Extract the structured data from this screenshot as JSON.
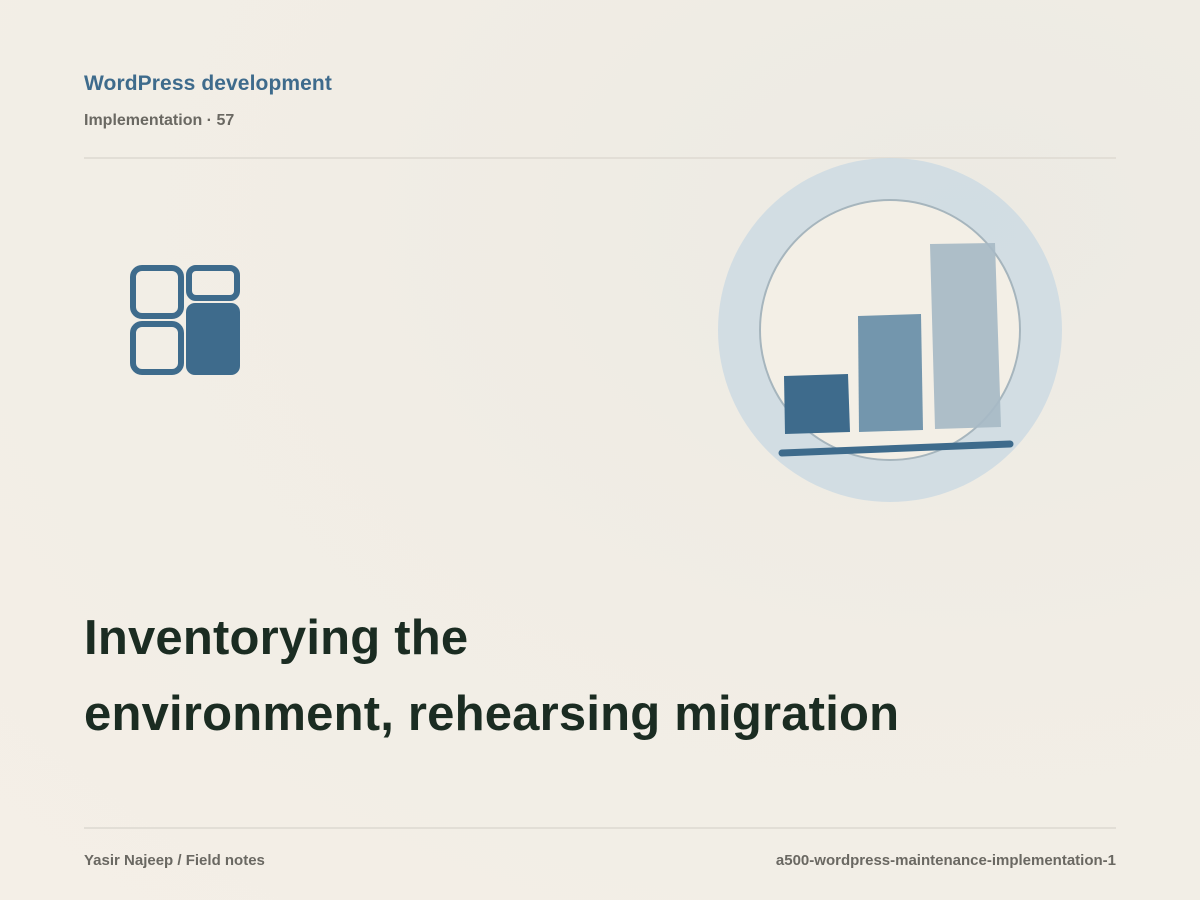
{
  "header": {
    "brand": "WordPress development",
    "meta": "Implementation · 57"
  },
  "headline": {
    "line1": "Inventorying the",
    "line2": "environment, rehearsing migration"
  },
  "footer": {
    "author": "Yasir Najeep / Field notes",
    "slug": "a500-wordpress-maintenance-implementation-1"
  },
  "icons": {
    "left_icon": "dashboard-grid-icon",
    "right_illustration": "bar-chart-icon"
  },
  "colors": {
    "accent": "#3e6b8c",
    "headline": "#1b2c22",
    "muted": "#6a6862",
    "halo": "#ccdbe3",
    "bar_mid": "#7396ad",
    "bar_light": "#a7bac6"
  }
}
